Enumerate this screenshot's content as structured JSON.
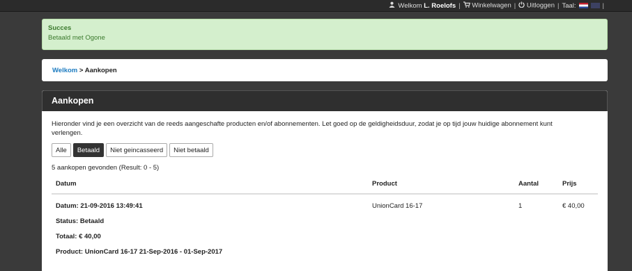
{
  "topbar": {
    "welcome_prefix": "Welkom",
    "user_name": "L. Roelofs",
    "cart_label": "Winkelwagen",
    "logout_label": "Uitloggen",
    "language_label": "Taal:",
    "separator": "|"
  },
  "alert": {
    "title": "Succes",
    "message": "Betaald met Ogone"
  },
  "breadcrumb": {
    "home": "Welkom",
    "separator": ">",
    "current": "Aankopen"
  },
  "panel": {
    "title": "Aankopen",
    "intro": "Hieronder vind je een overzicht van de reeds aangeschafte producten en/of abonnementen. Let goed op de geldigheidsduur, zodat je op tijd jouw huidige abonnement kunt verlengen.",
    "filters": [
      "Alle",
      "Betaald",
      "Niet geincasseerd",
      "Niet betaald"
    ],
    "active_filter": "Betaald",
    "count_text": "5 aankopen gevonden (Result: 0 - 5)"
  },
  "table": {
    "headers": {
      "date": "Datum",
      "product": "Product",
      "qty": "Aantal",
      "price": "Prijs"
    },
    "rows": [
      {
        "date": "Datum: 21-09-2016 13:49:41",
        "product": "UnionCard 16-17",
        "qty": "1",
        "price": "€ 40,00",
        "status": "Status: Betaald",
        "total": "Totaal: € 40,00",
        "product_detail": "Product: UnionCard 16-17 21-Sep-2016 - 01-Sep-2017"
      }
    ]
  },
  "colors": {
    "topbar_bg": "#2b2b2b",
    "alert_bg": "#d4efcd",
    "alert_text": "#3c7a2e",
    "link": "#1c7bc0",
    "panel_header": "#2f2f2f"
  }
}
